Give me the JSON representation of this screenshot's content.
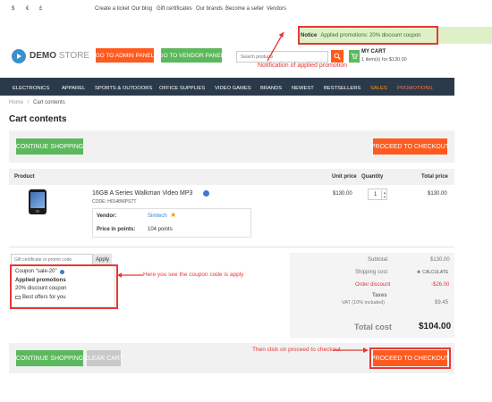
{
  "topbar": {
    "currency_1": "$",
    "currency_2": "€",
    "currency_3": "£",
    "links": [
      "Create a ticket",
      "Our blog",
      "Gift certificates",
      "Our brands",
      "Become a seller",
      "Vendors"
    ],
    "notice_label": "Notice",
    "notice_text": "Applied promotions: 20% discount coupon"
  },
  "header": {
    "logo_bold": "DEMO",
    "logo_light": " STORE",
    "admin_button": "GO TO ADMIN PANEL",
    "vendor_button": "GO TO VENDOR PANEL",
    "search_placeholder": "Search products",
    "cart_title": "MY CART",
    "cart_summary": "1 item(s) for $130.00",
    "annotation": "Notification of applied promotion"
  },
  "nav": {
    "items": [
      "ELECTRONICS",
      "APPAREL",
      "SPORTS & OUTDOORS",
      "OFFICE SUPPLIES",
      "VIDEO GAMES",
      "BRANDS",
      "NEWEST",
      "BESTSELLERS",
      "SALES",
      "PROMOTIONS"
    ]
  },
  "breadcrumb": {
    "home": "Home",
    "sep": "/",
    "current": "Cart contents"
  },
  "page": {
    "title": "Cart contents",
    "continue_shopping": "CONTINUE SHOPPING",
    "proceed_checkout": "PROCEED TO CHECKOUT",
    "clear_cart": "CLEAR CART"
  },
  "table": {
    "col_product": "Product",
    "col_unit_price": "Unit price",
    "col_quantity": "Quantity",
    "col_total": "Total price"
  },
  "item": {
    "name": "16GB A Series Walkman Video MP3",
    "code": "CODE: H0148WPSTT",
    "vendor_label": "Vendor:",
    "vendor_value": "Simtech",
    "points_label": "Price in points:",
    "points_value": "104 points",
    "unit_price": "$130.00",
    "quantity": "1",
    "total_price": "$130.00"
  },
  "coupon": {
    "placeholder": "Gift certificate or promo code",
    "apply": "Apply",
    "code_line": "Coupon \"sale-20\"",
    "promos_title": "Applied promotions",
    "promo_1": "20% discount coupon",
    "promo_2": "Best offers for you",
    "annotation": "Here you see the coupon code is apply"
  },
  "totals": {
    "subtotal_label": "Subtotal",
    "subtotal_value": "$130.00",
    "shipping_label": "Shipping cost",
    "shipping_value": "CALCULATE",
    "discount_label": "Order discount",
    "discount_value": "-$26.00",
    "taxes_label": "Taxes",
    "vat_label": "VAT (10% included)",
    "vat_value": "$9.45",
    "total_label": "Total cost",
    "total_value": "$104.00"
  },
  "footer_annotation": "Then click on proceed to checkout",
  "colors": {
    "green": "#5cb85c",
    "orange_red": "#ff5a1f",
    "navy": "#2b3a4a",
    "sales": "#ff9800",
    "promotions": "#ff7043",
    "annotation_red": "#e53935"
  }
}
